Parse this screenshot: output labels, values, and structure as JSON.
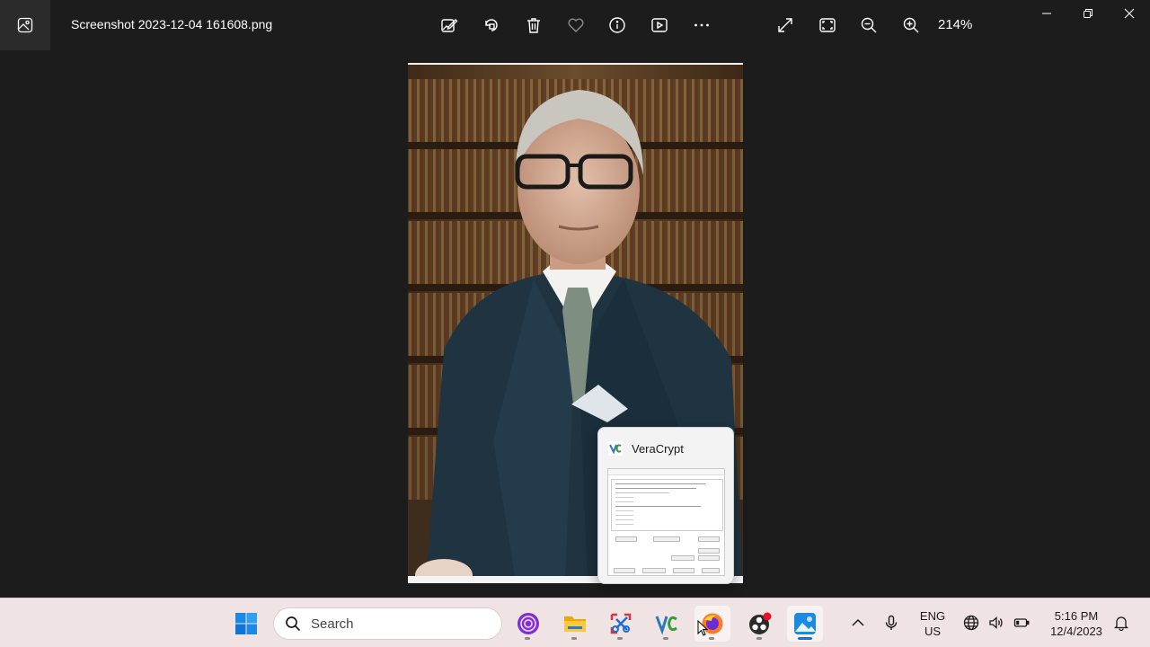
{
  "window": {
    "filename": "Screenshot 2023-12-04 161608.png",
    "zoom": "214%",
    "toolbar_icons": [
      "edit-image-icon",
      "rotate-icon",
      "delete-icon",
      "favorite-heart-icon",
      "info-icon",
      "slideshow-icon",
      "more-icon"
    ],
    "view_icons": [
      "fullscreen-icon",
      "fit-to-window-icon",
      "zoom-out-icon",
      "zoom-in-icon"
    ]
  },
  "preview": {
    "title": "VeraCrypt"
  },
  "taskbar": {
    "search_placeholder": "Search",
    "pinned": [
      "windows-start-icon",
      "search-icon",
      "tor-browser-icon",
      "file-explorer-icon",
      "snipping-tool-icon",
      "veracrypt-icon",
      "firefox-icon",
      "obs-studio-icon",
      "photos-icon"
    ],
    "language_line1": "ENG",
    "language_line2": "US",
    "time": "5:16 PM",
    "date": "12/4/2023"
  },
  "colors": {
    "background": "#1c1c1c",
    "taskbar": "#efe3e3",
    "accent": "#1d6fd1",
    "recording": "#e81123"
  }
}
